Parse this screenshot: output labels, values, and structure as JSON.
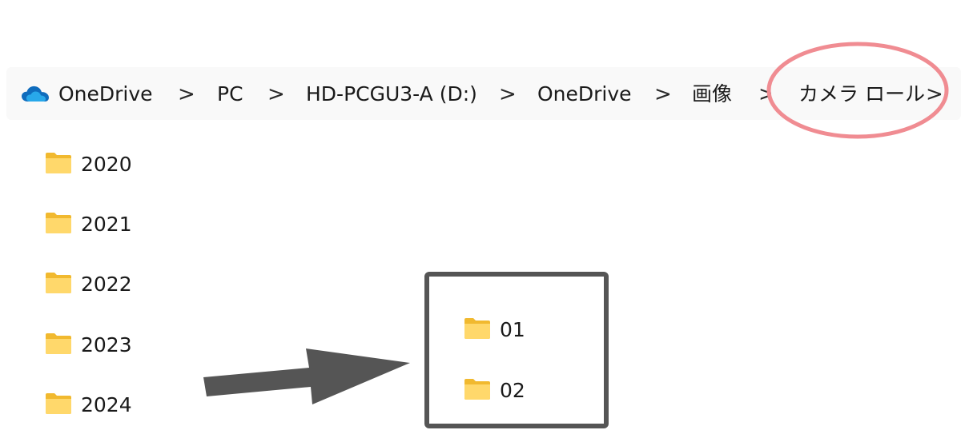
{
  "breadcrumb": {
    "items": [
      {
        "label": "OneDrive",
        "icon": "onedrive-cloud-icon"
      },
      {
        "label": "PC"
      },
      {
        "label": "HD-PCGU3-A (D:)"
      },
      {
        "label": "OneDrive"
      },
      {
        "label": "画像"
      },
      {
        "label": "カメラ ロール"
      }
    ],
    "separator": ">"
  },
  "folders": [
    {
      "name": "2020"
    },
    {
      "name": "2021"
    },
    {
      "name": "2022"
    },
    {
      "name": "2023"
    },
    {
      "name": "2024"
    }
  ],
  "callout": {
    "subfolders": [
      {
        "name": "01"
      },
      {
        "name": "02"
      }
    ]
  },
  "colors": {
    "highlight_ellipse": "#f08c92",
    "callout_border": "#555555",
    "arrow": "#555555",
    "folder_light": "#ffd86b",
    "folder_dark": "#f1b92f",
    "onedrive_blue": "#0f6cbd"
  }
}
